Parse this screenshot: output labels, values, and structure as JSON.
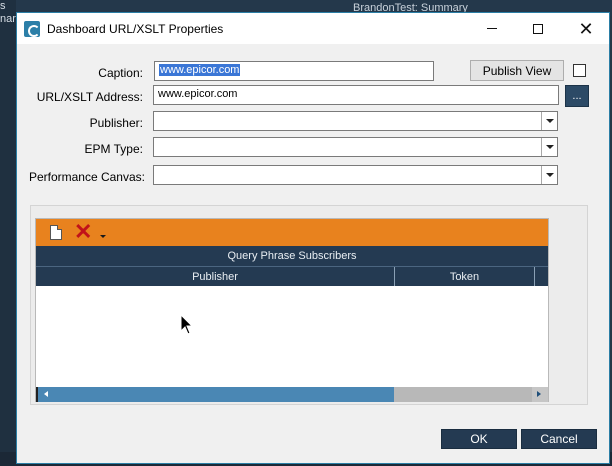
{
  "background": {
    "left_texts": [
      "s",
      "nar"
    ],
    "top_title": "BrandonTest: Summary"
  },
  "dialog": {
    "title": "Dashboard URL/XSLT Properties",
    "window_controls": {
      "minimize_icon": "minimize-icon",
      "maximize_icon": "maximize-icon",
      "close_icon": "close-icon"
    },
    "form": {
      "caption_label": "Caption:",
      "caption_value": "www.epicor.com",
      "url_label": "URL/XSLT Address:",
      "url_value": "www.epicor.com",
      "publisher_label": "Publisher:",
      "publisher_value": "",
      "epm_label": "EPM Type:",
      "epm_value": "",
      "canvas_label": "Performance Canvas:",
      "canvas_value": "",
      "publish_view_label": "Publish View",
      "publish_view_checked": false,
      "browse_button_label": "..."
    },
    "grid": {
      "toolbar": {
        "new_icon": "new-document-icon",
        "delete_icon": "delete-x-icon",
        "dropdown_icon": "dropdown-arrow-icon"
      },
      "title": "Query Phrase Subscribers",
      "columns": [
        "Publisher",
        "Token"
      ],
      "rows": []
    },
    "buttons": {
      "ok": "OK",
      "cancel": "Cancel"
    }
  },
  "colors": {
    "accent_orange": "#e8821e",
    "header_navy": "#243a52",
    "titlebar_border": "#2b7fa6",
    "selection_blue": "#3a76d6"
  }
}
